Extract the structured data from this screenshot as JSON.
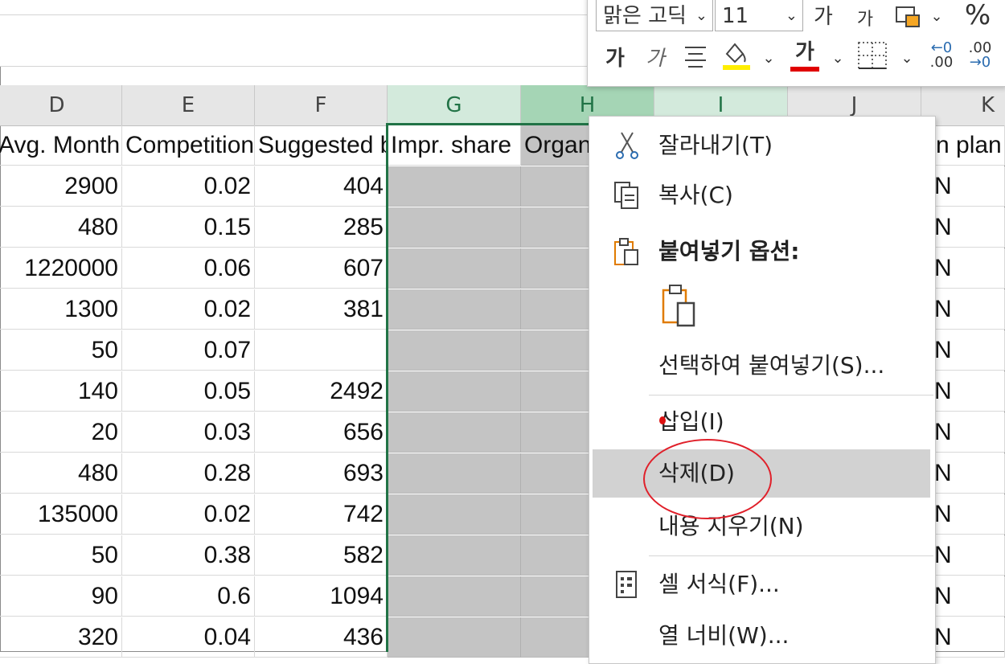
{
  "columns": [
    {
      "letter": "D",
      "state": "normal"
    },
    {
      "letter": "E",
      "state": "normal"
    },
    {
      "letter": "F",
      "state": "normal"
    },
    {
      "letter": "G",
      "state": "selected"
    },
    {
      "letter": "H",
      "state": "selected-active"
    },
    {
      "letter": "I",
      "state": "selected"
    },
    {
      "letter": "J",
      "state": "normal"
    },
    {
      "letter": "K",
      "state": "normal"
    }
  ],
  "header_row": {
    "d": "Avg. Monthly Searches",
    "e": "Competition",
    "f": "Suggested bid",
    "g": "Impr. share",
    "h": "Organic",
    "k": "n plan"
  },
  "rows": [
    {
      "d": "2900",
      "e": "0.02",
      "f": "404"
    },
    {
      "d": "480",
      "e": "0.15",
      "f": "285"
    },
    {
      "d": "1220000",
      "e": "0.06",
      "f": "607"
    },
    {
      "d": "1300",
      "e": "0.02",
      "f": "381"
    },
    {
      "d": "50",
      "e": "0.07",
      "f": ""
    },
    {
      "d": "140",
      "e": "0.05",
      "f": "2492"
    },
    {
      "d": "20",
      "e": "0.03",
      "f": "656"
    },
    {
      "d": "480",
      "e": "0.28",
      "f": "693"
    },
    {
      "d": "135000",
      "e": "0.02",
      "f": "742"
    },
    {
      "d": "50",
      "e": "0.38",
      "f": "582"
    },
    {
      "d": "90",
      "e": "0.6",
      "f": "1094"
    },
    {
      "d": "320",
      "e": "0.04",
      "f": "436"
    }
  ],
  "k_col_value": "N",
  "mini_toolbar": {
    "font_name": "맑은 고딕",
    "font_size": "11",
    "grow_font": "가",
    "shrink_font": "가",
    "percent": "%",
    "bold": "가",
    "italic": "가",
    "font_color_glyph": "가",
    "inc_decimal": ".00",
    "dec_decimal": ".00",
    "fill_color": "#ffee00",
    "font_color": "#e00000"
  },
  "context_menu": {
    "cut": "잘라내기(T)",
    "copy": "복사(C)",
    "paste_options": "붙여넣기 옵션:",
    "paste_special": "선택하여 붙여넣기(S)...",
    "insert": "삽입(I)",
    "delete": "삭제(D)",
    "clear_contents": "내용 지우기(N)",
    "format_cells": "셀 서식(F)...",
    "column_width": "열 너비(W)..."
  },
  "colors": {
    "selection_accent": "#217346",
    "highlight_circle": "#e0202a"
  }
}
